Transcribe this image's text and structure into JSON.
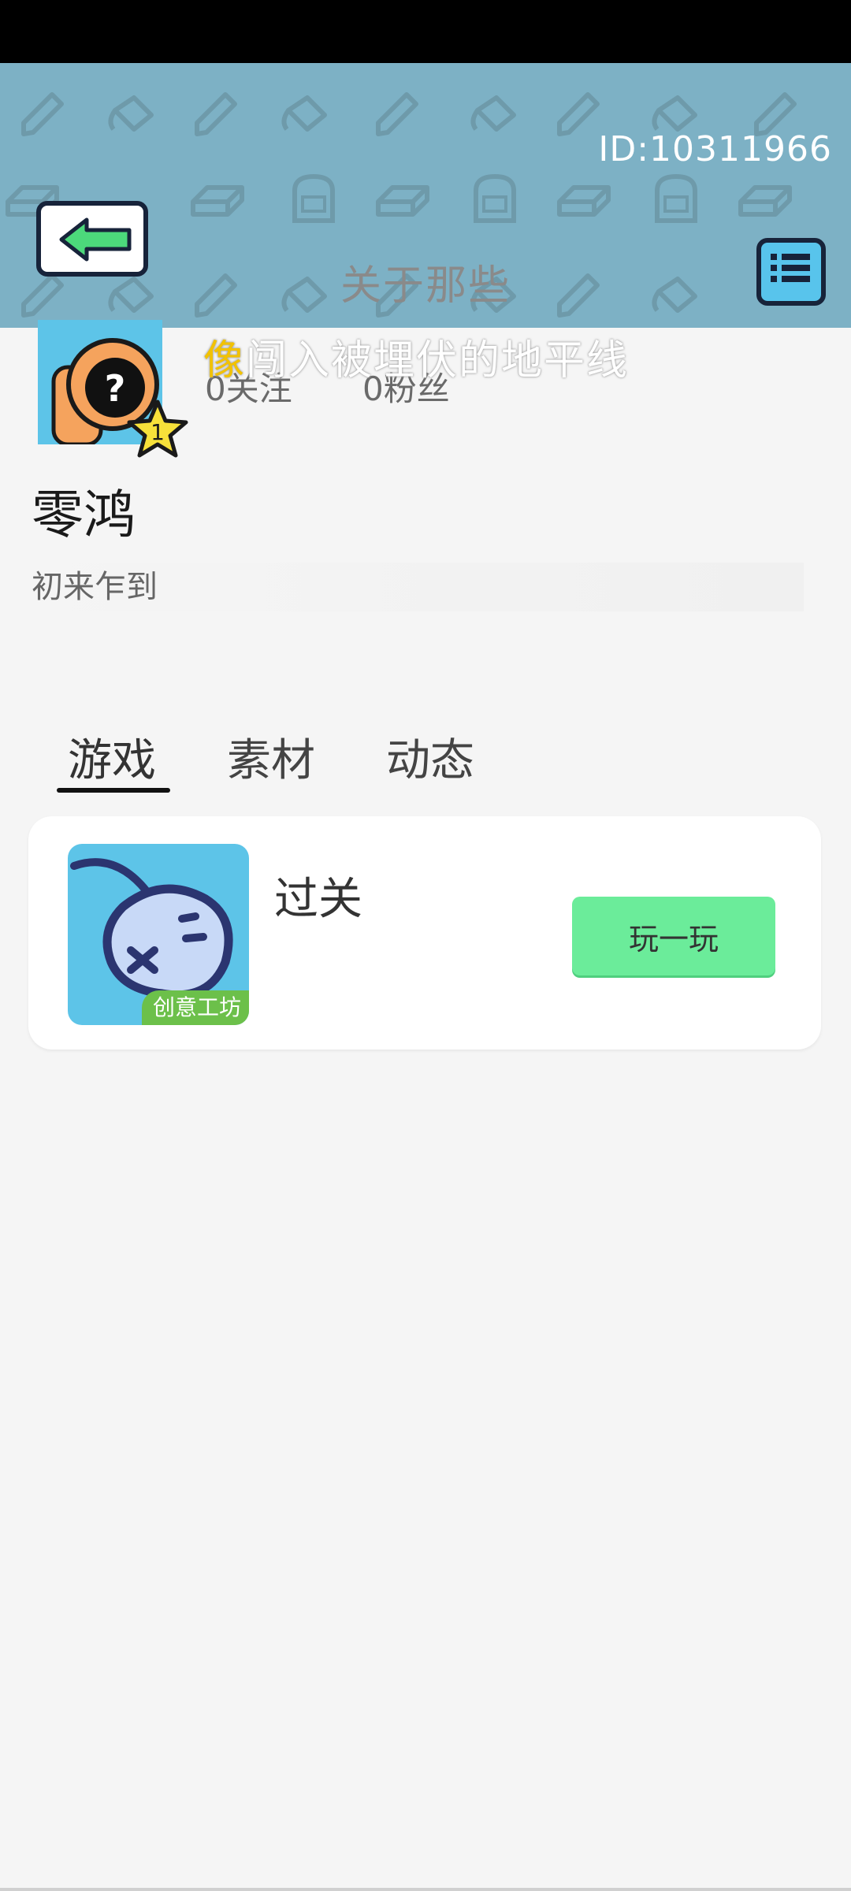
{
  "header": {
    "user_id": "ID:10311966",
    "title": "关于那些",
    "marquee_first_char": "像",
    "marquee_rest": "闯入被埋伏的地平线"
  },
  "profile": {
    "level": "1",
    "follow_count": "0关注",
    "fans_count": "0粉丝",
    "username": "零鸿",
    "bio": "初来乍到"
  },
  "tabs": [
    {
      "label": "游戏"
    },
    {
      "label": "素材"
    },
    {
      "label": "动态"
    }
  ],
  "active_tab": "游戏",
  "games": [
    {
      "title": "过关",
      "badge": "创意工坊",
      "play_label": "玩一玩"
    }
  ],
  "colors": {
    "header_bg": "#7db1c5",
    "accent_green": "#6bec9a",
    "back_arrow": "#4cd97b",
    "thumb_bg": "#5dc4e8",
    "badge_green": "#6cc04a"
  }
}
